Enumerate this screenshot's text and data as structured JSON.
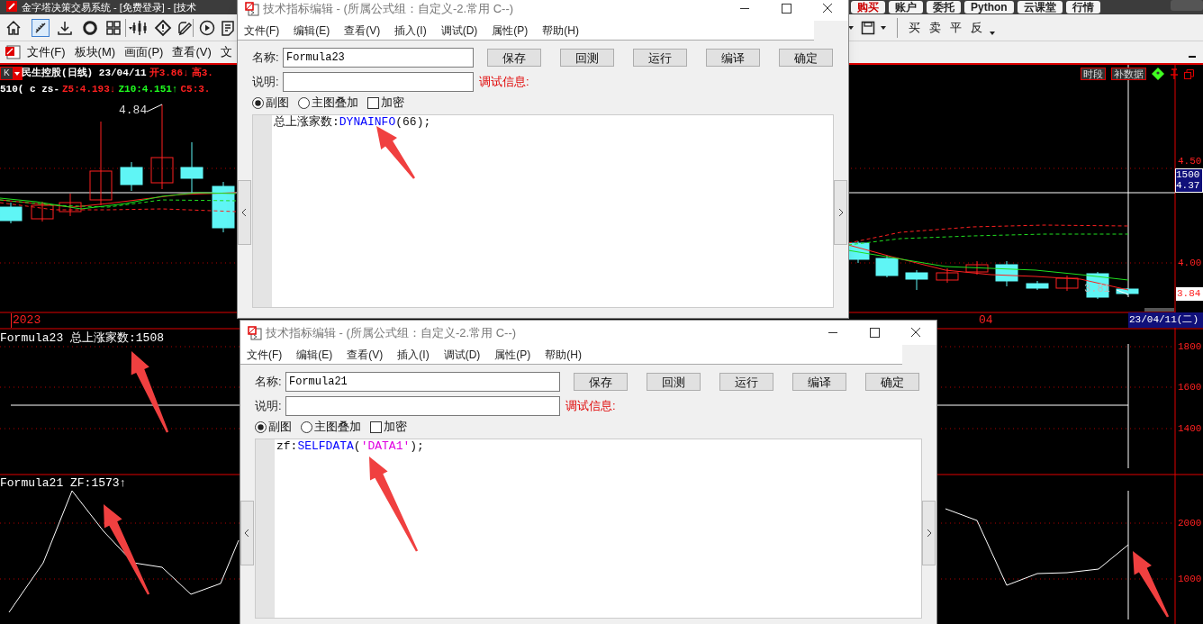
{
  "app": {
    "title": "金字塔决策交易系统 - [免费登录] - [技术",
    "top_buttons": [
      {
        "label": "购买",
        "color": "#cc0000"
      },
      {
        "label": "账户",
        "color": "#222222"
      },
      {
        "label": "委托",
        "color": "#222222"
      },
      {
        "label": "Python",
        "color": "#222222"
      },
      {
        "label": "云课堂",
        "color": "#222222"
      },
      {
        "label": "行情",
        "color": "#222222"
      }
    ],
    "trade_buttons": [
      "买",
      "卖",
      "平",
      "反"
    ],
    "menu": [
      "文件(F)",
      "板块(M)",
      "画面(P)",
      "查看(V)",
      "文"
    ]
  },
  "chart": {
    "period_selector": "K",
    "stock_header": [
      {
        "text": "民生控股(日线) 23/04/11",
        "color": "#ffffff"
      },
      {
        "text": "开3.86↓",
        "color": "#ff2020"
      },
      {
        "text": "高3.",
        "color": "#ff2020"
      }
    ],
    "indicator_line": [
      {
        "text": "510( c  zs-",
        "color": "#ffffff"
      },
      {
        "text": "Z5:4.193↓",
        "color": "#ff2020"
      },
      {
        "text": "Z10:4.151↑",
        "color": "#20ff20"
      },
      {
        "text": "C5:3.",
        "color": "#ff2020"
      }
    ],
    "high_label": "4.84",
    "low_label": "3.81",
    "price_axis": [
      "4.50",
      "4.00"
    ],
    "crosshair_volume": "1500",
    "crosshair_price": "4.37",
    "last_price": "3.84",
    "x_axis": [
      "2023",
      "04"
    ],
    "cursor_date": "23/04/11(二)",
    "tools": [
      "时段",
      "补数据"
    ],
    "panes": [
      {
        "legend": "Formula23 总上涨家数:1508",
        "axis": [
          "1800",
          "1600",
          "1400"
        ]
      },
      {
        "legend": "Formula21 ZF:1573↑",
        "axis": [
          "2000",
          "1000"
        ]
      }
    ]
  },
  "editor_windows": [
    {
      "title": "技术指标编辑 - (所属公式组：自定义-2.常用 C--)",
      "menu": [
        "文件(F)",
        "编辑(E)",
        "查看(V)",
        "插入(I)",
        "调试(D)",
        "属性(P)",
        "帮助(H)"
      ],
      "name_label": "名称:",
      "name": "Formula23",
      "buttons": [
        "保存",
        "回测",
        "运行",
        "编译",
        "确定"
      ],
      "desc_label": "说明:",
      "debug_label": "调试信息:",
      "options": [
        {
          "label": "副图",
          "kind": "radio",
          "checked": true
        },
        {
          "label": "主图叠加",
          "kind": "radio",
          "checked": false
        },
        {
          "label": "加密",
          "kind": "checkbox",
          "checked": false
        }
      ],
      "code": [
        {
          "text": "总上涨家数:",
          "kind": "plain"
        },
        {
          "text": "DYNAINFO",
          "kind": "function"
        },
        {
          "text": "(66);",
          "kind": "plain"
        }
      ]
    },
    {
      "title": "技术指标编辑 - (所属公式组：自定义-2.常用 C--)",
      "menu": [
        "文件(F)",
        "编辑(E)",
        "查看(V)",
        "插入(I)",
        "调试(D)",
        "属性(P)",
        "帮助(H)"
      ],
      "name_label": "名称:",
      "name": "Formula21",
      "buttons": [
        "保存",
        "回测",
        "运行",
        "编译",
        "确定"
      ],
      "desc_label": "说明:",
      "debug_label": "调试信息:",
      "options": [
        {
          "label": "副图",
          "kind": "radio",
          "checked": true
        },
        {
          "label": "主图叠加",
          "kind": "radio",
          "checked": false
        },
        {
          "label": "加密",
          "kind": "checkbox",
          "checked": false
        }
      ],
      "code": [
        {
          "text": "zf:",
          "kind": "plain"
        },
        {
          "text": "SELFDATA",
          "kind": "function"
        },
        {
          "text": "(",
          "kind": "plain"
        },
        {
          "text": "'DATA1'",
          "kind": "string"
        },
        {
          "text": ");",
          "kind": "plain"
        }
      ]
    }
  ]
}
